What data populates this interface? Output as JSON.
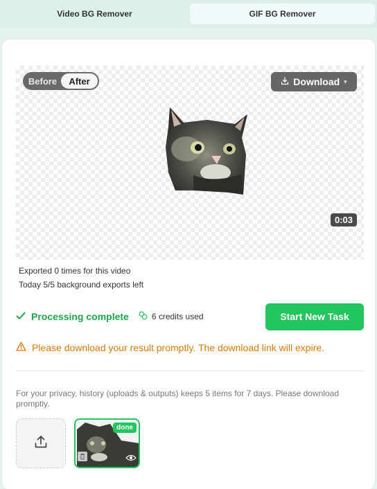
{
  "tabs": [
    {
      "label": "Video BG Remover",
      "active": false
    },
    {
      "label": "GIF BG Remover",
      "active": true
    }
  ],
  "preview": {
    "toggle_before": "Before",
    "toggle_after": "After",
    "toggle_selected": "After",
    "download_label": "Download",
    "timestamp": "0:03"
  },
  "info": {
    "exported": "Exported 0 times for this video",
    "exports_left": "Today 5/5 background exports left"
  },
  "status": {
    "complete_label": "Processing complete",
    "credits_label": "6 credits used",
    "start_button": "Start New Task"
  },
  "warning": "Please download your result promptly. The download link will expire.",
  "privacy_note": "For your privacy, history (uploads & outputs) keeps 5 items for 7 days. Please download promptly.",
  "history": {
    "items": [
      {
        "badge": "done"
      }
    ]
  },
  "colors": {
    "accent_green": "#23c55e",
    "status_green": "#1fa34a",
    "warning_orange": "#d97a06"
  },
  "icons": [
    "download-icon",
    "chevron-down-icon",
    "check-icon",
    "coins-icon",
    "warning-icon",
    "upload-icon",
    "trash-icon",
    "eye-icon"
  ]
}
